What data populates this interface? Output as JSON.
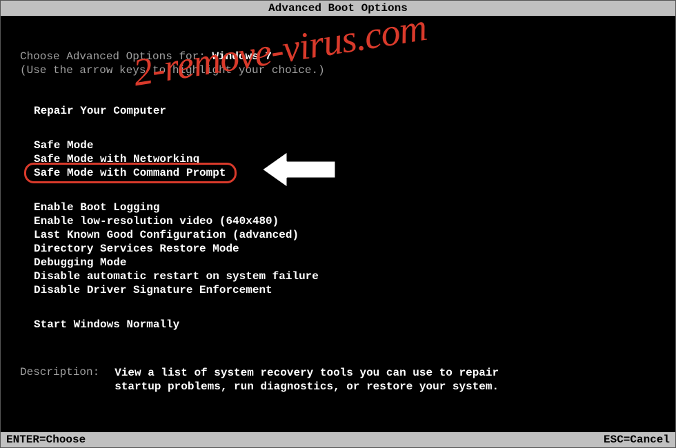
{
  "title": "Advanced Boot Options",
  "prompt": {
    "prefix": "Choose Advanced Options for: ",
    "os": "Windows 7",
    "hint": "(Use the arrow keys to highlight your choice.)"
  },
  "sections": {
    "repair": "Repair Your Computer",
    "safe_modes": [
      "Safe Mode",
      "Safe Mode with Networking",
      "Safe Mode with Command Prompt"
    ],
    "options": [
      "Enable Boot Logging",
      "Enable low-resolution video (640x480)",
      "Last Known Good Configuration (advanced)",
      "Directory Services Restore Mode",
      "Debugging Mode",
      "Disable automatic restart on system failure",
      "Disable Driver Signature Enforcement"
    ],
    "normal": "Start Windows Normally"
  },
  "description": {
    "label": "Description:",
    "text": "View a list of system recovery tools you can use to repair startup problems, run diagnostics, or restore your system."
  },
  "footer": {
    "enter": "ENTER=Choose",
    "esc": "ESC=Cancel"
  },
  "watermark": "2-remove-virus.com"
}
